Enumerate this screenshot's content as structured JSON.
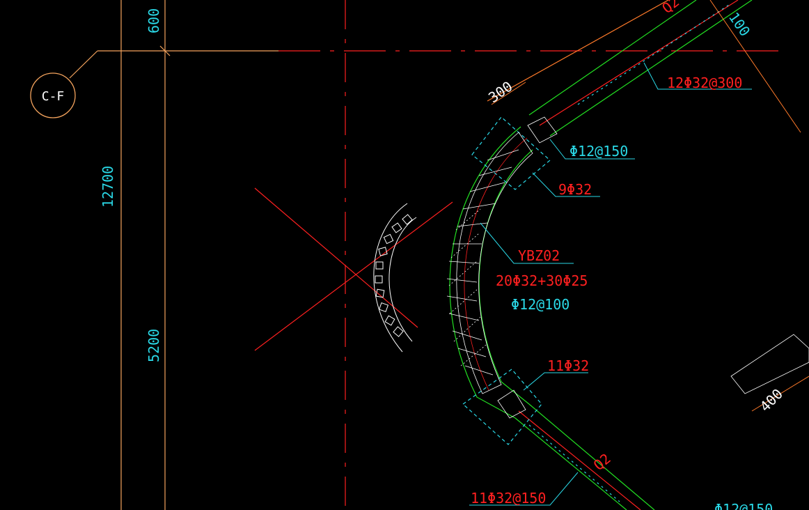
{
  "colors": {
    "background": "#000000",
    "axis_line": "#f5a45e",
    "center_line": "#ff2020",
    "wall_outline": "#22e022",
    "member": "#ffffff",
    "cyan_text": "#2ad8e6",
    "red_text": "#ff2020",
    "dimension": "#ff7a2a"
  },
  "axis": {
    "bubble_label": "C-F"
  },
  "dimensions": {
    "d600": "600",
    "d12700": "12700",
    "d5200": "5200",
    "d300": "300",
    "d100": "100",
    "d400": "400"
  },
  "labels": {
    "wall_q2_top": "Q2",
    "wall_q2_bottom": "Q2",
    "rebar_top": "12Φ32@300",
    "stirrup_top": "Φ12@150",
    "bars_top": "9Φ32",
    "column_id": "YBZ02",
    "column_bars": "20Φ32+30Φ25",
    "column_stirrup": "Φ12@100",
    "bars_bottom": "11Φ32",
    "rebar_bottom": "11Φ32@150",
    "stirrup_bottom_right": "Φ12@150"
  }
}
